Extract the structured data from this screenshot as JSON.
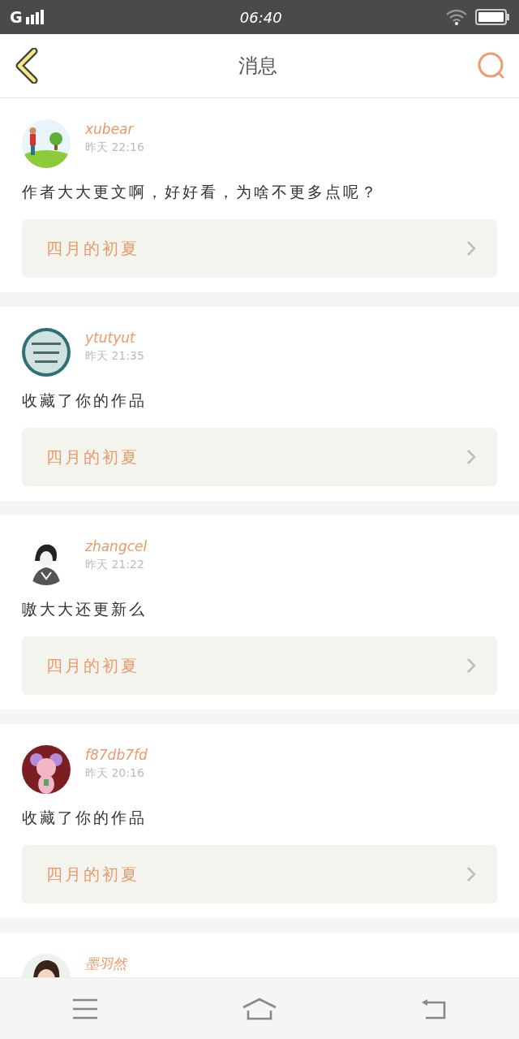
{
  "status_bar": {
    "network": "G",
    "time": "06:40"
  },
  "header": {
    "title": "消息"
  },
  "messages": [
    {
      "user": "xubear",
      "time": "昨天  22:16",
      "text": "作者大大更文啊，好好看，为啥不更多点呢？",
      "work": "四月的初夏"
    },
    {
      "user": "ytutyut",
      "time": "昨天  21:35",
      "text": "收藏了你的作品",
      "work": "四月的初夏"
    },
    {
      "user": "zhangcel",
      "time": "昨天  21:22",
      "text": "嗷大大还更新么",
      "work": "四月的初夏"
    },
    {
      "user": "f87db7fd",
      "time": "昨天  20:16",
      "text": "收藏了你的作品",
      "work": "四月的初夏"
    },
    {
      "user": "墨羽然"
    }
  ]
}
